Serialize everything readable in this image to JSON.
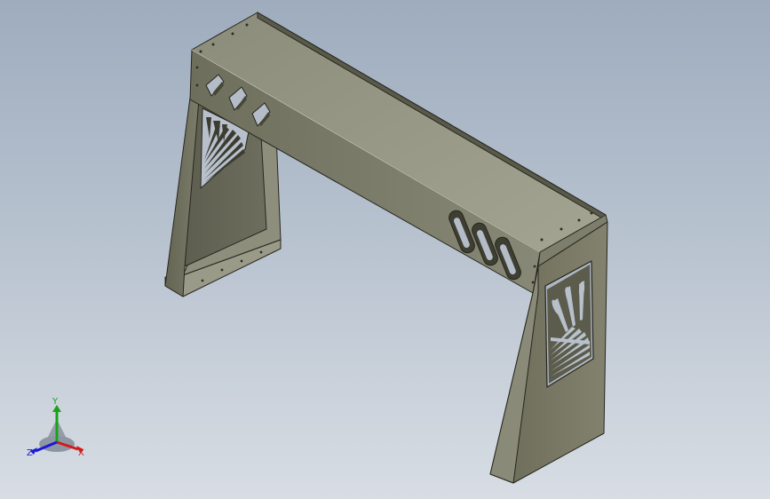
{
  "viewport": {
    "background_top": "#9eacbe",
    "background_bottom": "#d8dde4"
  },
  "model": {
    "face_color": "#7a7a68",
    "edge_color": "#26261e"
  },
  "triad": {
    "x_label": "X",
    "y_label": "Y",
    "z_label": "Z",
    "x_color": "#d21a1a",
    "y_color": "#1aa31a",
    "z_color": "#1a1ad2"
  }
}
